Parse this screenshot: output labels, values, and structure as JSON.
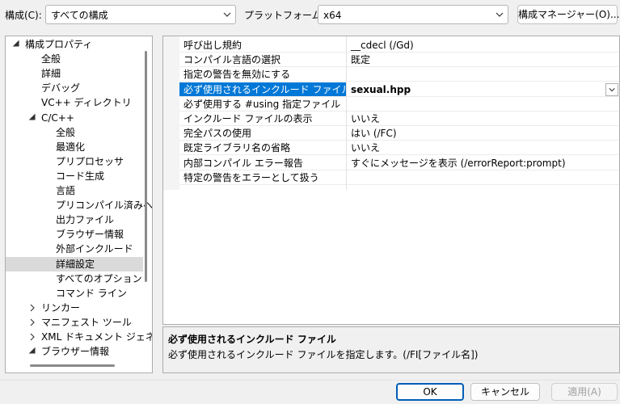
{
  "toolbar": {
    "config_label": "構成(C):",
    "config_value": "すべての構成",
    "platform_label": "プラットフォーム(P):",
    "platform_value": "x64",
    "manager_button": "構成マネージャー(O)..."
  },
  "tree": {
    "items": [
      {
        "label": "構成プロパティ",
        "expanded": true
      },
      {
        "label": "全般"
      },
      {
        "label": "詳細"
      },
      {
        "label": "デバッグ"
      },
      {
        "label": "VC++ ディレクトリ"
      },
      {
        "label": "C/C++",
        "expanded": true
      },
      {
        "label": "全般"
      },
      {
        "label": "最適化"
      },
      {
        "label": "プリプロセッサ"
      },
      {
        "label": "コード生成"
      },
      {
        "label": "言語"
      },
      {
        "label": "プリコンパイル済みヘッ"
      },
      {
        "label": "出力ファイル"
      },
      {
        "label": "ブラウザー情報"
      },
      {
        "label": "外部インクルード"
      },
      {
        "label": "詳細設定",
        "selected": true
      },
      {
        "label": "すべてのオプション"
      },
      {
        "label": "コマンド ライン"
      },
      {
        "label": "リンカー",
        "expanded": false
      },
      {
        "label": "マニフェスト ツール",
        "expanded": false
      },
      {
        "label": "XML ドキュメント ジェネレー",
        "expanded": false
      },
      {
        "label": "ブラウザー情報",
        "expanded": true
      }
    ]
  },
  "grid": {
    "rows": [
      {
        "name": "呼び出し規約",
        "value": "__cdecl (/Gd)"
      },
      {
        "name": "コンパイル言語の選択",
        "value": "既定"
      },
      {
        "name": "指定の警告を無効にする",
        "value": ""
      },
      {
        "name": "必ず使用されるインクルード ファイル",
        "value": "sexual.hpp",
        "selected": true
      },
      {
        "name": "必ず使用する #using 指定ファイル",
        "value": ""
      },
      {
        "name": "インクルード ファイルの表示",
        "value": "いいえ"
      },
      {
        "name": "完全パスの使用",
        "value": "はい (/FC)"
      },
      {
        "name": "既定ライブラリ名の省略",
        "value": "いいえ"
      },
      {
        "name": "内部コンパイル エラー報告",
        "value": "すぐにメッセージを表示 (/errorReport:prompt)"
      },
      {
        "name": "特定の警告をエラーとして扱う",
        "value": ""
      }
    ]
  },
  "description": {
    "title": "必ず使用されるインクルード ファイル",
    "text": "必ず使用されるインクルード ファイルを指定します。(/FI[ファイル名])"
  },
  "buttons": {
    "ok": "OK",
    "cancel": "キャンセル",
    "apply": "適用(A)"
  },
  "colors": {
    "selection": "#0078d7",
    "tree_selection": "#dadada",
    "primary_border": "#005fb8"
  }
}
